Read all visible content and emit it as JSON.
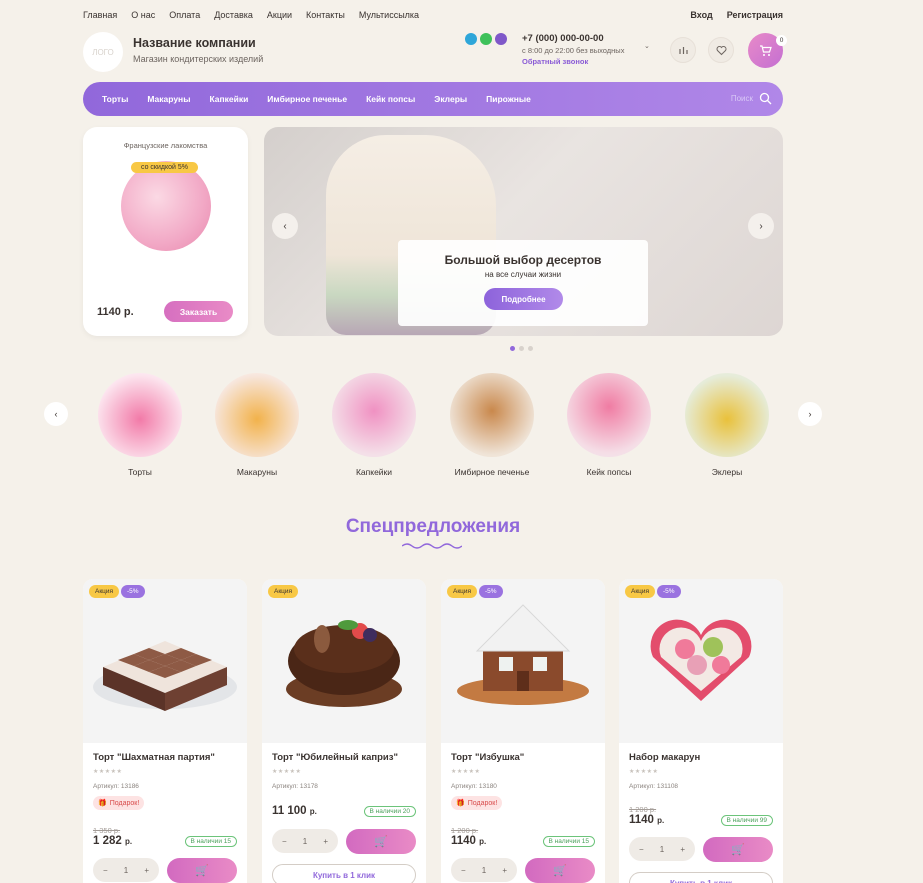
{
  "topnav": {
    "items": [
      "Главная",
      "О нас",
      "Оплата",
      "Доставка",
      "Акции",
      "Контакты",
      "Мультиссылка"
    ],
    "login": "Вход",
    "register": "Регистрация"
  },
  "header": {
    "logo": "ЛОГО",
    "company": "Название компании",
    "subtitle": "Магазин кондитерских изделий",
    "phone": "+7 (000) 000-00-00",
    "hours": "с 8:00 до 22:00 без выходных",
    "callback": "Обратный звонок",
    "cart_count": "0"
  },
  "menu": {
    "items": [
      "Торты",
      "Макаруны",
      "Капкейки",
      "Имбирное печенье",
      "Кейк попсы",
      "Эклеры",
      "Пирожные"
    ],
    "search": "Поиск"
  },
  "promo": {
    "title": "Французские лакомства",
    "badge": "со скидкой 5%",
    "price": "1140 р.",
    "button": "Заказать"
  },
  "banner": {
    "title": "Большой выбор десертов",
    "subtitle": "на все случаи жизни",
    "button": "Подробнее"
  },
  "categories": [
    "Торты",
    "Макаруны",
    "Капкейки",
    "Имбирное печенье",
    "Кейк попсы",
    "Эклеры"
  ],
  "section_title": "Спецпредложения",
  "products": [
    {
      "sale": "Акция",
      "disc": "-5%",
      "name": "Торт \"Шахматная партия\"",
      "stars": "★★★★★",
      "sku": "Артикул: 13186",
      "gift": "Подарок!",
      "old": "1 350 р.",
      "price": "1 282",
      "unit": "р.",
      "stock": "В наличии 15",
      "qty": "1",
      "oneclick": ""
    },
    {
      "sale": "Акция",
      "disc": "",
      "name": "Торт \"Юбилейный каприз\"",
      "stars": "★★★★★",
      "sku": "Артикул: 13178",
      "gift": "",
      "old": "",
      "price": "11 100",
      "unit": "р.",
      "stock": "В наличии 20",
      "qty": "1",
      "oneclick": "Купить в 1 клик"
    },
    {
      "sale": "Акция",
      "disc": "-5%",
      "name": "Торт \"Избушка\"",
      "stars": "★★★★★",
      "sku": "Артикул: 13180",
      "gift": "Подарок!",
      "old": "1 200 р.",
      "price": "1140",
      "unit": "р.",
      "stock": "В наличии 15",
      "qty": "1",
      "oneclick": ""
    },
    {
      "sale": "Акция",
      "disc": "-5%",
      "name": "Набор макарун",
      "stars": "★★★★★",
      "sku": "Артикул: 131108",
      "gift": "",
      "old": "1 200 р.",
      "price": "1140",
      "unit": "р.",
      "stock": "В наличии 99",
      "qty": "1",
      "oneclick": "Купить в 1 клик"
    }
  ]
}
